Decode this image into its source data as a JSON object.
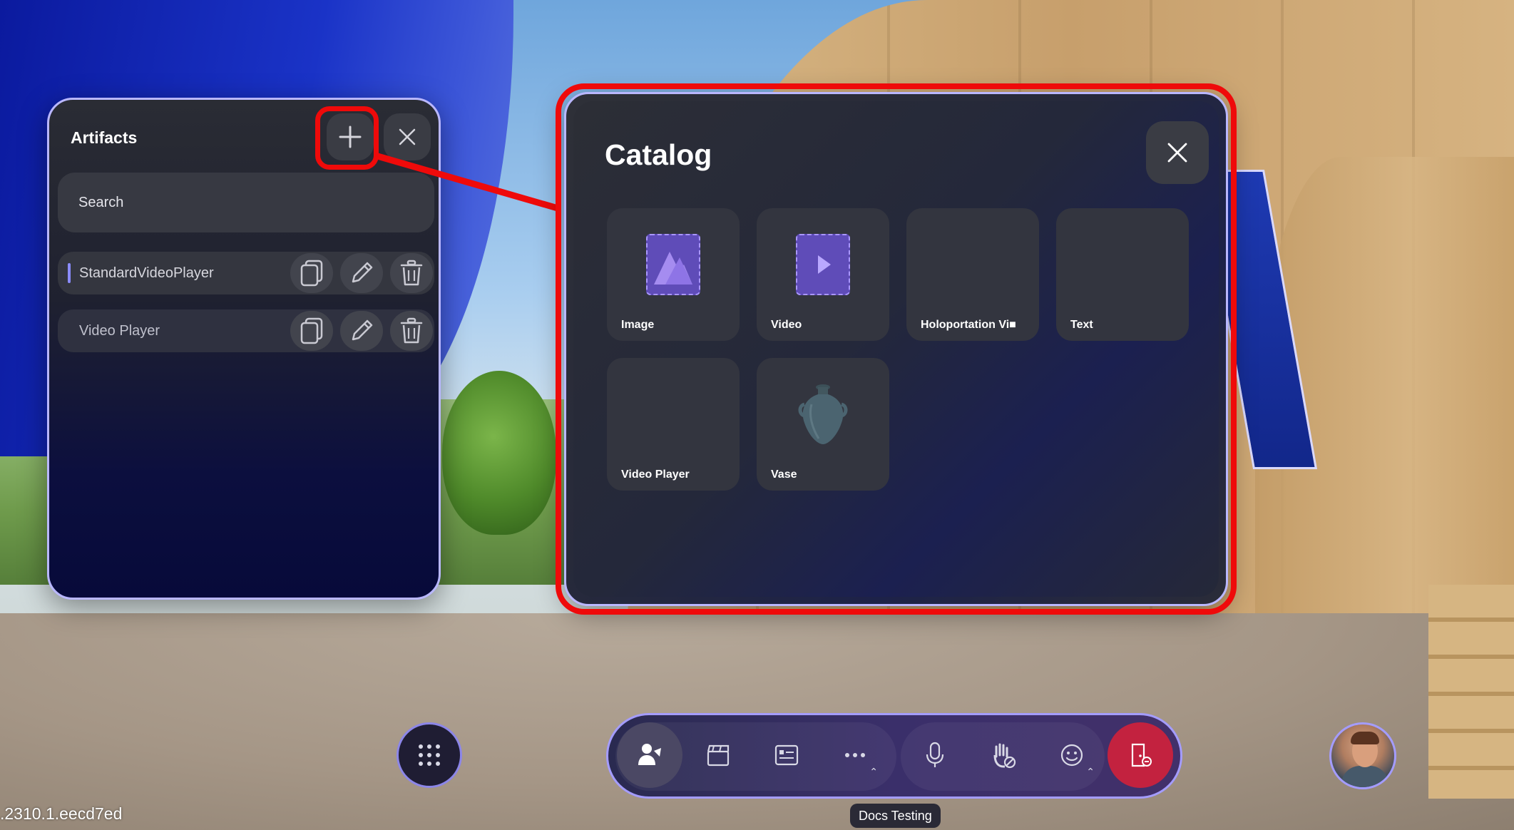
{
  "version": ".2310.1.eecd7ed",
  "artifacts": {
    "title": "Artifacts",
    "add_icon": "plus-icon",
    "close_icon": "close-icon",
    "search_placeholder": "Search",
    "items": [
      {
        "label": "StandardVideoPlayer",
        "selected": true
      },
      {
        "label": "Video Player",
        "selected": false
      }
    ],
    "row_action_icons": [
      "copy-icon",
      "edit-icon",
      "delete-icon"
    ]
  },
  "catalog": {
    "title": "Catalog",
    "close_icon": "close-icon",
    "items": [
      {
        "label": "Image",
        "icon": "image-thumbnail"
      },
      {
        "label": "Video",
        "icon": "video-thumbnail"
      },
      {
        "label": "Holoportation  Vi■",
        "icon": ""
      },
      {
        "label": "Text",
        "icon": ""
      },
      {
        "label": "Video  Player",
        "icon": ""
      },
      {
        "label": "Vase",
        "icon": "vase-thumbnail"
      }
    ]
  },
  "toolbar": {
    "apps_icon": "grid-icon",
    "buttons": [
      "participants-icon",
      "clapperboard-icon",
      "content-icon",
      "more-icon",
      "microphone-icon",
      "raise-hand-icon",
      "emoji-icon",
      "leave-icon"
    ],
    "meeting_name": "Docs Testing"
  },
  "colors": {
    "highlight": "#ef0a0a",
    "accent": "#a49cff",
    "leave": "#c3223f"
  }
}
